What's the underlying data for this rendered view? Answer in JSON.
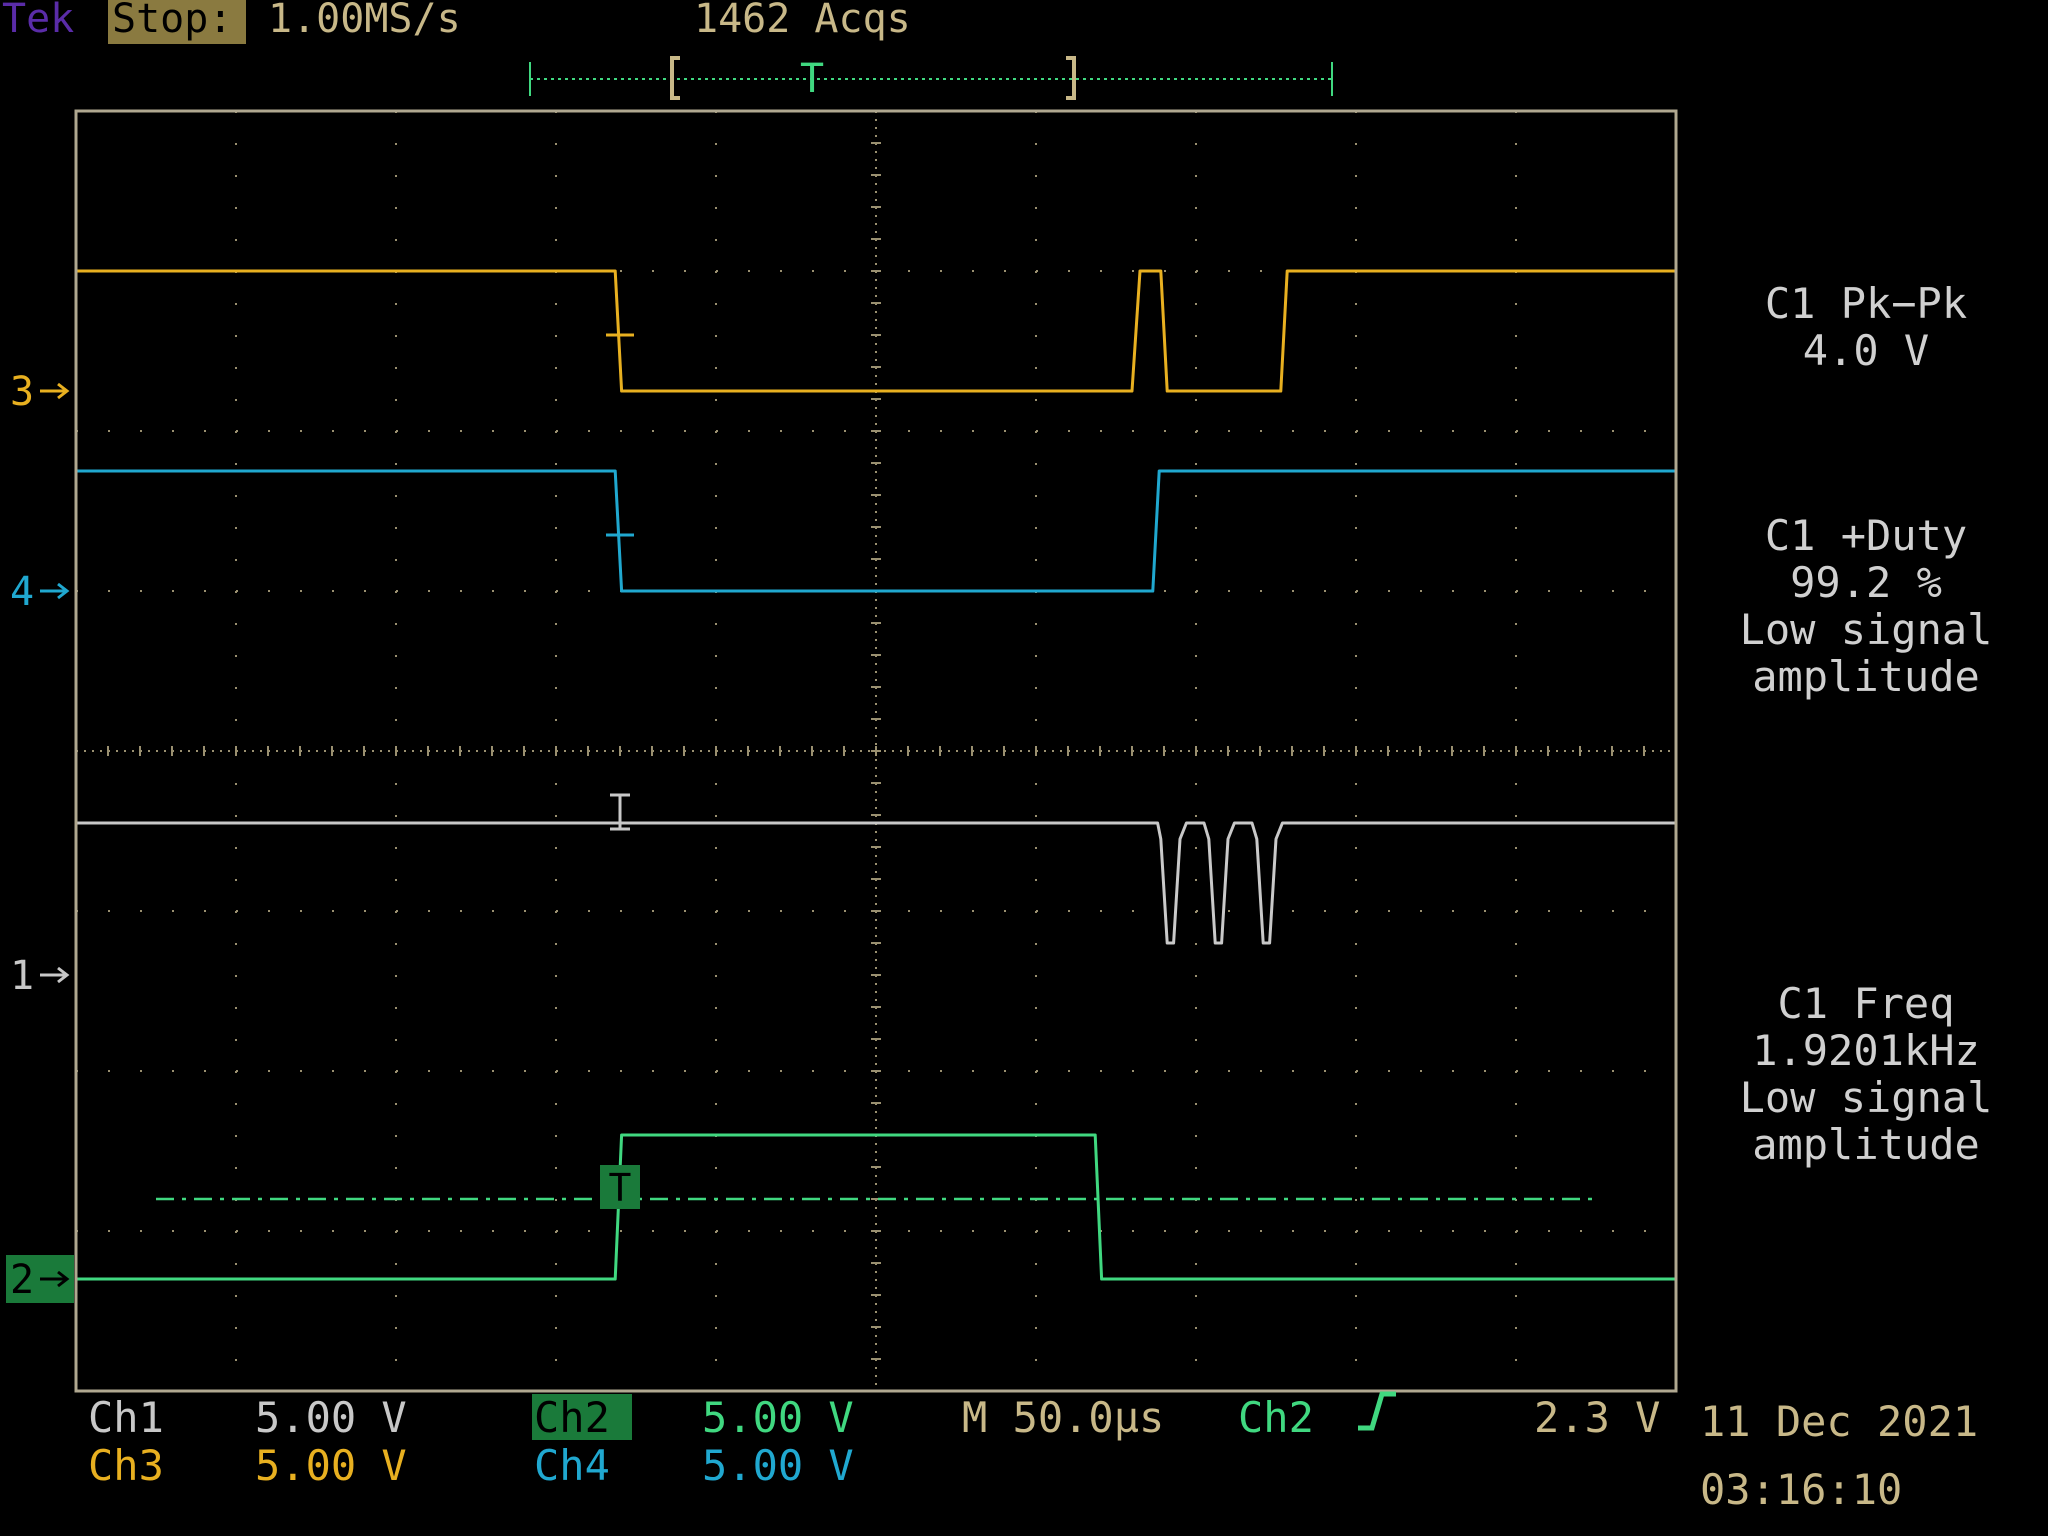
{
  "header": {
    "brand": "Tek",
    "run_state": "Stop:",
    "sample_rate": "1.00MS/s",
    "acquisitions": "1462 Acqs",
    "trigger_marker": "T"
  },
  "measurements": [
    {
      "label": "C1 Pk−Pk",
      "lines": [
        "4.0 V"
      ]
    },
    {
      "label": "C1 +Duty",
      "lines": [
        "99.2 %",
        "Low signal",
        "amplitude"
      ]
    },
    {
      "label": "C1 Freq",
      "lines": [
        "1.9201kHz",
        "Low signal",
        "amplitude"
      ]
    }
  ],
  "footer": {
    "ch1": {
      "name": "Ch1",
      "scale": "5.00 V"
    },
    "ch2": {
      "name": "Ch2",
      "scale": "5.00 V"
    },
    "ch3": {
      "name": "Ch3",
      "scale": "5.00 V"
    },
    "ch4": {
      "name": "Ch4",
      "scale": "5.00 V"
    },
    "timebase": "M 50.0µs",
    "trigger_source": "Ch2",
    "trigger_slope_icon": "rising-edge-icon",
    "trigger_level": "2.3 V",
    "date": "11 Dec 2021",
    "time": "03:16:10"
  },
  "colors": {
    "background": "#000000",
    "graticule": "#9a9070",
    "frame": "#b0a890",
    "ch1": "#c8c8c8",
    "ch2": "#40d880",
    "ch3": "#e8b020",
    "ch4": "#20a8d0",
    "brand": "#5a2ca8",
    "stop_bg": "#8a7a40",
    "header_text": "#c8b888",
    "meas_text": "#d0d0d0",
    "timebase_text": "#c8b888"
  },
  "chart_data": {
    "type": "line",
    "x_unit": "div",
    "y_unit": "div",
    "xlim": [
      0,
      10
    ],
    "ylim": [
      -4,
      4
    ],
    "grid": true,
    "graticule": {
      "h_divisions": 10,
      "v_divisions": 8
    },
    "channel_markers": [
      {
        "channel": "3",
        "level": 2.25
      },
      {
        "channel": "4",
        "level": 1.0
      },
      {
        "channel": "1",
        "level": -1.4
      },
      {
        "channel": "2",
        "level": -3.3
      }
    ],
    "trigger_level_line": {
      "channel": "Ch2",
      "level": -2.8
    },
    "trigger_position": 4.5,
    "series": [
      {
        "name": "Ch3",
        "color": "#e8b020",
        "x": [
          0,
          3.37,
          3.41,
          6.6,
          6.65,
          6.78,
          6.82,
          7.53,
          7.57,
          10
        ],
        "y": [
          3.0,
          3.0,
          2.25,
          2.25,
          3.0,
          3.0,
          2.25,
          2.25,
          3.0,
          3.0
        ]
      },
      {
        "name": "Ch4",
        "color": "#20a8d0",
        "x": [
          0,
          3.37,
          3.41,
          6.73,
          6.77,
          10
        ],
        "y": [
          1.75,
          1.75,
          1.0,
          1.0,
          1.75,
          1.75
        ]
      },
      {
        "name": "Ch1",
        "color": "#c8c8c8",
        "x": [
          0,
          6.76,
          6.78,
          6.82,
          6.86,
          6.9,
          6.94,
          7.05,
          7.08,
          7.12,
          7.16,
          7.2,
          7.24,
          7.35,
          7.38,
          7.42,
          7.46,
          7.5,
          7.54,
          10
        ],
        "y": [
          -0.45,
          -0.45,
          -0.55,
          -1.2,
          -1.2,
          -0.55,
          -0.45,
          -0.45,
          -0.55,
          -1.2,
          -1.2,
          -0.55,
          -0.45,
          -0.45,
          -0.55,
          -1.2,
          -1.2,
          -0.55,
          -0.45,
          -0.45
        ]
      },
      {
        "name": "Ch2",
        "color": "#40d880",
        "x": [
          0,
          3.37,
          3.41,
          6.37,
          6.41,
          10
        ],
        "y": [
          -3.3,
          -3.3,
          -2.4,
          -2.4,
          -3.3,
          -3.3
        ]
      }
    ]
  }
}
